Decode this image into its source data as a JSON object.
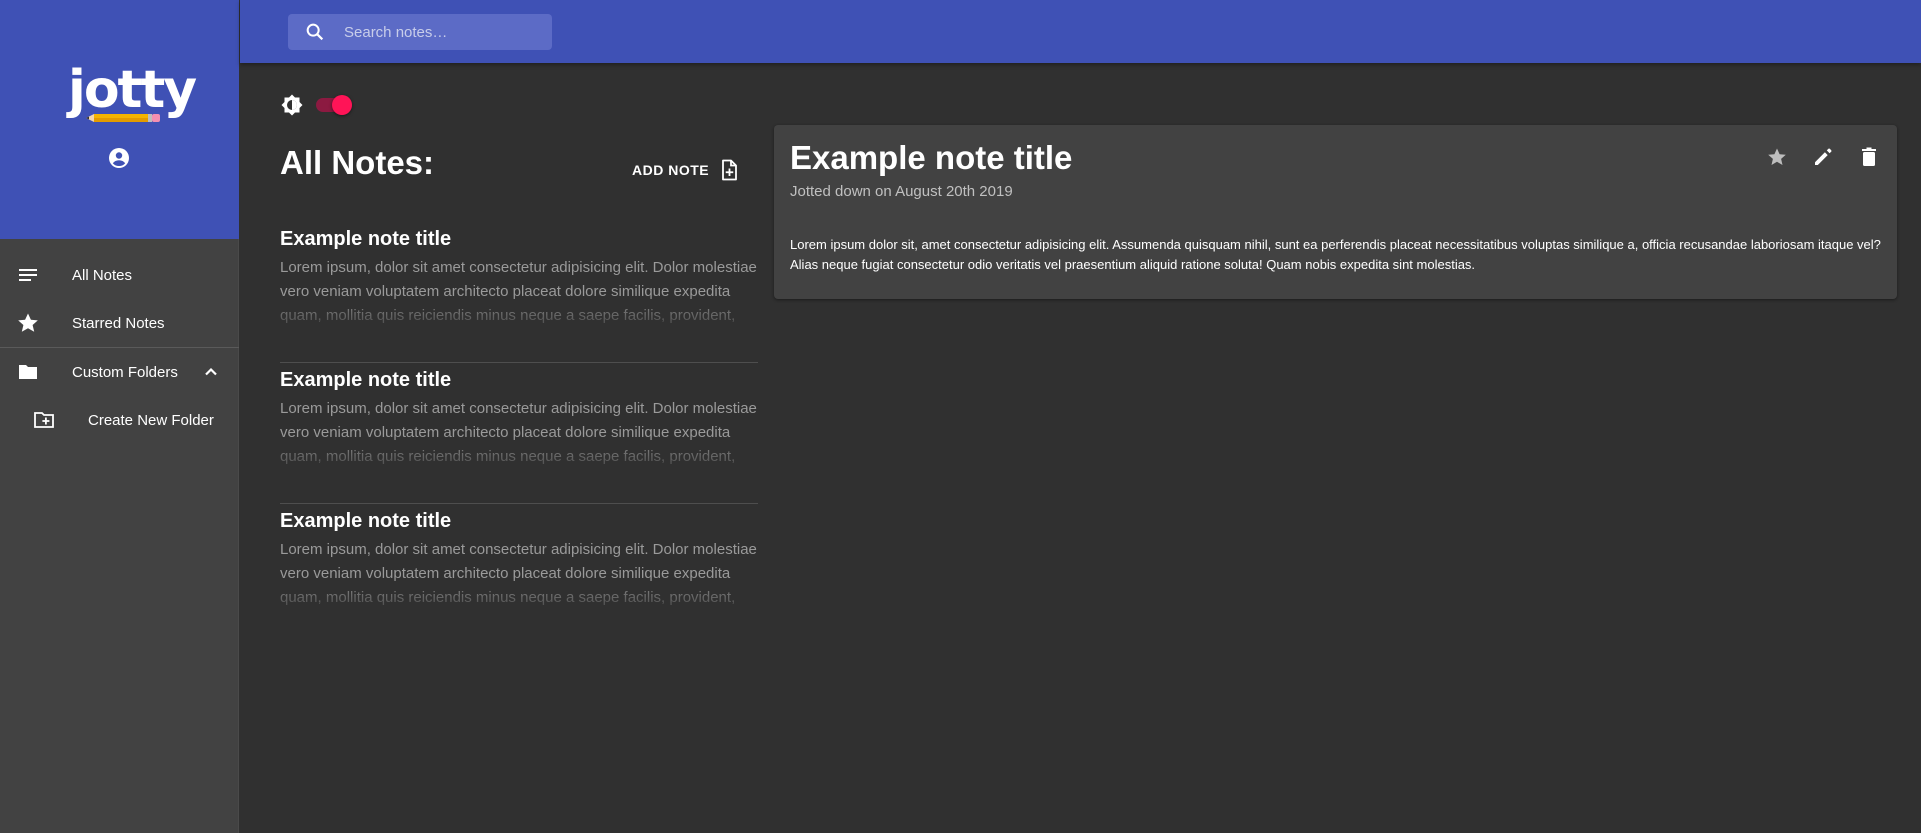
{
  "app": {
    "logo_text": "jotty"
  },
  "sidebar": {
    "items": [
      {
        "label": "All Notes",
        "icon": "list-icon"
      },
      {
        "label": "Starred Notes",
        "icon": "star-icon"
      },
      {
        "label": "Custom Folders",
        "icon": "folder-icon",
        "expanded": true
      },
      {
        "label": "Create New Folder",
        "icon": "create-folder-icon"
      }
    ]
  },
  "search": {
    "placeholder": "Search notes…",
    "value": ""
  },
  "theme": {
    "dark_mode": true,
    "icon": "brightness-icon"
  },
  "list": {
    "title": "All Notes:",
    "add_label": "ADD NOTE",
    "notes": [
      {
        "title": "Example note title",
        "excerpt": "Lorem ipsum, dolor sit amet consectetur adipisicing elit. Dolor molestiae vero veniam voluptatem architecto placeat dolore similique expedita quam, mollitia quis reiciendis minus neque a saepe facilis, provident, eum"
      },
      {
        "title": "Example note title",
        "excerpt": "Lorem ipsum, dolor sit amet consectetur adipisicing elit. Dolor molestiae vero veniam voluptatem architecto placeat dolore similique expedita quam, mollitia quis reiciendis minus neque a saepe facilis, provident, eum"
      },
      {
        "title": "Example note title",
        "excerpt": "Lorem ipsum, dolor sit amet consectetur adipisicing elit. Dolor molestiae vero veniam voluptatem architecto placeat dolore similique expedita quam, mollitia quis reiciendis minus neque a saepe facilis, provident, eum"
      }
    ]
  },
  "note": {
    "title": "Example note title",
    "date": "Jotted down on August 20th 2019",
    "body": "Lorem ipsum dolor sit, amet consectetur adipisicing elit. Assumenda quisquam nihil, sunt ea perferendis placeat necessitatibus voluptas similique a, officia recusandae laboriosam itaque vel? Alias neque fugiat consectetur odio veritatis vel praesentium aliquid ratione soluta! Quam nobis expedita sint molestias."
  },
  "colors": {
    "primary": "#3f51b5",
    "accent": "#ff1457",
    "background": "#303030",
    "surface": "#424242"
  }
}
